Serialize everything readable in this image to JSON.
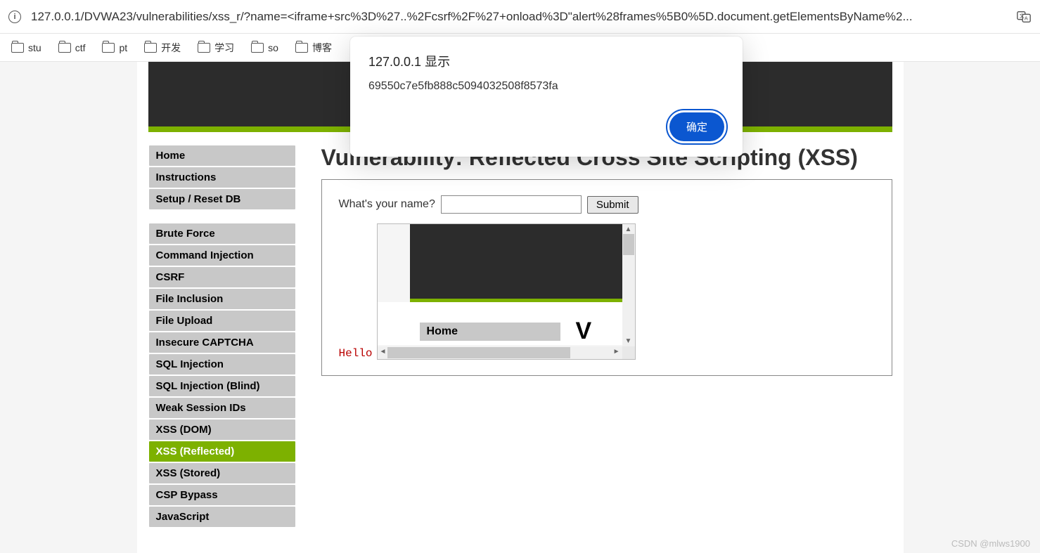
{
  "browser": {
    "url": "127.0.0.1/DVWA23/vulnerabilities/xss_r/?name=<iframe+src%3D%27..%2Fcsrf%2F%27+onload%3D\"alert%28frames%5B0%5D.document.getElementsByName%2...",
    "info_icon_label": "i"
  },
  "bookmarks": [
    {
      "label": "stu"
    },
    {
      "label": "ctf"
    },
    {
      "label": "pt"
    },
    {
      "label": "开发"
    },
    {
      "label": "学习"
    },
    {
      "label": "so"
    },
    {
      "label": "博客"
    }
  ],
  "dialog": {
    "title": "127.0.0.1 显示",
    "message": "69550c7e5fb888c5094032508f8573fa",
    "ok": "确定"
  },
  "sidebar": {
    "group1": [
      {
        "label": "Home"
      },
      {
        "label": "Instructions"
      },
      {
        "label": "Setup / Reset DB"
      }
    ],
    "group2": [
      {
        "label": "Brute Force"
      },
      {
        "label": "Command Injection"
      },
      {
        "label": "CSRF"
      },
      {
        "label": "File Inclusion"
      },
      {
        "label": "File Upload"
      },
      {
        "label": "Insecure CAPTCHA"
      },
      {
        "label": "SQL Injection"
      },
      {
        "label": "SQL Injection (Blind)"
      },
      {
        "label": "Weak Session IDs"
      },
      {
        "label": "XSS (DOM)"
      },
      {
        "label": "XSS (Reflected)",
        "active": true
      },
      {
        "label": "XSS (Stored)"
      },
      {
        "label": "CSP Bypass"
      },
      {
        "label": "JavaScript"
      }
    ]
  },
  "main": {
    "title": "Vulnerability: Reflected Cross Site Scripting (XSS)",
    "form_label": "What's your name?",
    "input_value": "",
    "submit": "Submit",
    "hello": "Hello",
    "iframe_home": "Home",
    "iframe_v": "V"
  },
  "watermark": "CSDN @mlws1900"
}
